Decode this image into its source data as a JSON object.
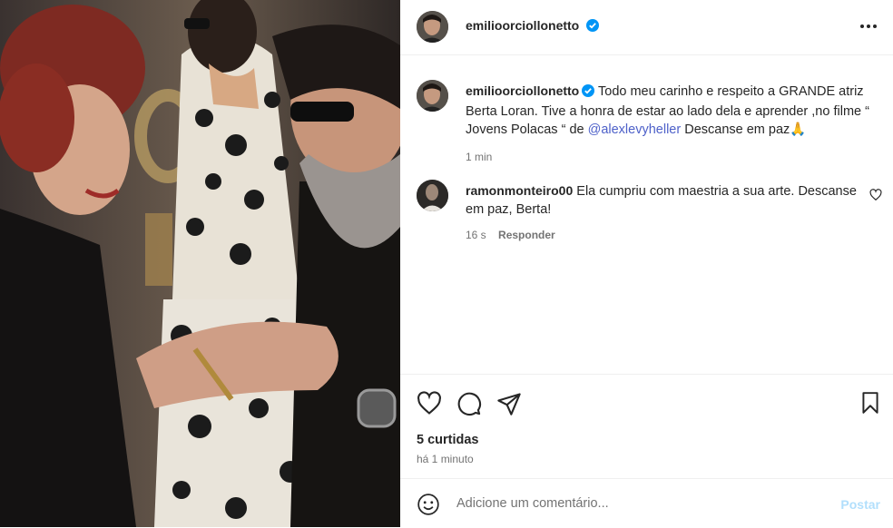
{
  "post": {
    "author": "emilioorciollonetto",
    "more_icon": "more-horizontal-icon",
    "verified_icon": "verified-badge-icon",
    "accent_color": "#0095f6"
  },
  "caption": {
    "author": "emilioorciollonetto",
    "text_before": " Todo meu carinho e respeito a GRANDE atriz Berta Loran. Tive a honra de estar ao lado dela e aprender ,no filme “ Jovens Polacas “ de ",
    "mention": "@alexlevyheller",
    "text_after": " Descanse em paz",
    "emoji": "🙏",
    "time": "1 min"
  },
  "comments": [
    {
      "author": "ramonmonteiro00",
      "text": " Ela cumpriu com maestria a sua arte. Descanse em paz, Berta!",
      "time": "16 s",
      "reply_label": "Responder"
    }
  ],
  "actions": {
    "like_icon": "heart-icon",
    "comment_icon": "comment-icon",
    "share_icon": "share-icon",
    "save_icon": "bookmark-icon",
    "likes": "5 curtidas",
    "posted": "há 1 minuto"
  },
  "composer": {
    "emoji_icon": "emoji-icon",
    "placeholder": "Adicione um comentário...",
    "post_label": "Postar",
    "post_color": "#b2dffc"
  }
}
